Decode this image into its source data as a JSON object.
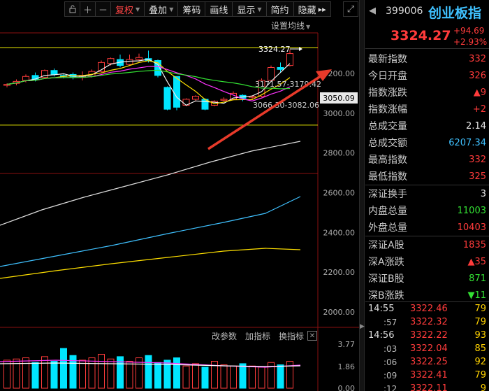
{
  "toolbar": {
    "items": [
      {
        "label": "复权",
        "dropdown": true,
        "active": true
      },
      {
        "label": "叠加",
        "dropdown": true
      },
      {
        "label": "筹码"
      },
      {
        "label": "画线"
      },
      {
        "label": "显示",
        "dropdown": true
      },
      {
        "label": "简约"
      },
      {
        "label": "隐藏"
      }
    ],
    "icons": [
      "lock-icon",
      "plus-icon",
      "minus-icon"
    ],
    "hide_arrows": "▸▸",
    "expand_glyph": "⤢"
  },
  "ma_setting": "设置均线",
  "chart_data": {
    "type": "candlestick",
    "price_label": "3324.27",
    "current_price_tag": "3050.09",
    "ma_annotations": [
      "3171.57-3179.42",
      "3066.30-3082.06"
    ],
    "y_ticks": [
      "3200.00",
      "3000.00",
      "2800.00",
      "2600.00",
      "2400.00",
      "2200.00",
      "2000.00"
    ],
    "volume_ticks": [
      "3.77",
      "1.86",
      "0.00"
    ],
    "ylim": [
      1950,
      3350
    ],
    "candles": [
      {
        "o": 3140,
        "c": 3145,
        "h": 3150,
        "l": 3130
      },
      {
        "o": 3150,
        "c": 3160,
        "h": 3170,
        "l": 3140
      },
      {
        "o": 3165,
        "c": 3185,
        "h": 3195,
        "l": 3155
      },
      {
        "o": 3190,
        "c": 3170,
        "h": 3205,
        "l": 3160
      },
      {
        "o": 3180,
        "c": 3215,
        "h": 3220,
        "l": 3175
      },
      {
        "o": 3215,
        "c": 3195,
        "h": 3225,
        "l": 3185
      },
      {
        "o": 3190,
        "c": 3185,
        "h": 3200,
        "l": 3175
      },
      {
        "o": 3195,
        "c": 3180,
        "h": 3205,
        "l": 3170
      },
      {
        "o": 3180,
        "c": 3190,
        "h": 3210,
        "l": 3165
      },
      {
        "o": 3185,
        "c": 3210,
        "h": 3220,
        "l": 3180
      },
      {
        "o": 3210,
        "c": 3255,
        "h": 3265,
        "l": 3205
      },
      {
        "o": 3250,
        "c": 3275,
        "h": 3280,
        "l": 3240
      },
      {
        "o": 3270,
        "c": 3240,
        "h": 3295,
        "l": 3230
      },
      {
        "o": 3245,
        "c": 3270,
        "h": 3295,
        "l": 3240
      },
      {
        "o": 3270,
        "c": 3280,
        "h": 3300,
        "l": 3260
      },
      {
        "o": 3275,
        "c": 3265,
        "h": 3315,
        "l": 3255
      },
      {
        "o": 3265,
        "c": 3190,
        "h": 3270,
        "l": 3180
      },
      {
        "o": 3130,
        "c": 3020,
        "h": 3135,
        "l": 3015
      },
      {
        "o": 3185,
        "c": 3030,
        "h": 3185,
        "l": 3015
      },
      {
        "o": 3040,
        "c": 3070,
        "h": 3075,
        "l": 3035
      },
      {
        "o": 3070,
        "c": 3085,
        "h": 3090,
        "l": 3060
      },
      {
        "o": 3070,
        "c": 3020,
        "h": 3075,
        "l": 3015
      },
      {
        "o": 3040,
        "c": 3060,
        "h": 3065,
        "l": 3035
      },
      {
        "o": 3065,
        "c": 3070,
        "h": 3080,
        "l": 3060
      },
      {
        "o": 3070,
        "c": 3100,
        "h": 3110,
        "l": 3065
      },
      {
        "o": 3090,
        "c": 3075,
        "h": 3095,
        "l": 3060
      },
      {
        "o": 3080,
        "c": 3085,
        "h": 3090,
        "l": 3070
      },
      {
        "o": 3085,
        "c": 3165,
        "h": 3175,
        "l": 3080
      },
      {
        "o": 3165,
        "c": 3230,
        "h": 3240,
        "l": 3160
      },
      {
        "o": 3230,
        "c": 3220,
        "h": 3255,
        "l": 3205
      },
      {
        "o": 3240,
        "c": 3300,
        "h": 3320,
        "l": 3235
      }
    ],
    "volumes": [
      2.4,
      2.5,
      2.6,
      2.2,
      2.7,
      2.3,
      3.4,
      2.8,
      2.4,
      2.6,
      2.9,
      2.5,
      2.7,
      2.3,
      2.6,
      2.8,
      2.2,
      2.4,
      2.6,
      1.9,
      2.1,
      1.8,
      2.3,
      2.0,
      1.9,
      2.1,
      1.9,
      1.8,
      2.2,
      2.0,
      2.3
    ]
  },
  "indicator_bar": [
    "改参数",
    "加指标",
    "换指标"
  ],
  "indicator_close": "✕",
  "panel": {
    "code": "399006",
    "name": "创业板指",
    "price": "3324.27",
    "change": "+94.69",
    "change_pct": "+2.93%",
    "stats_group1": [
      {
        "label": "最新指数",
        "value": "332",
        "color": "red"
      },
      {
        "label": "今日开盘",
        "value": "326",
        "color": "red"
      },
      {
        "label": "指数涨跌",
        "value": "▲9",
        "color": "red"
      },
      {
        "label": "指数涨幅",
        "value": "+2",
        "color": "red"
      },
      {
        "label": "总成交量",
        "value": "2.14",
        "color": "white"
      },
      {
        "label": "总成交额",
        "value": "6207.34",
        "color": "cyan"
      },
      {
        "label": "最高指数",
        "value": "332",
        "color": "red"
      },
      {
        "label": "最低指数",
        "value": "325",
        "color": "red"
      }
    ],
    "stats_group2": [
      {
        "label": "深证换手",
        "value": "3",
        "color": "white"
      },
      {
        "label": "内盘总量",
        "value": "11003",
        "color": "green"
      },
      {
        "label": "外盘总量",
        "value": "10403",
        "color": "red"
      }
    ],
    "stats_group3": [
      {
        "label": "深证A股",
        "value": "1835",
        "color": "red"
      },
      {
        "label": "深A涨跌",
        "value": "▲35",
        "color": "red"
      },
      {
        "label": "深证B股",
        "value": "871",
        "color": "green"
      },
      {
        "label": "深B涨跌",
        "value": "▼11",
        "color": "green"
      }
    ],
    "ticks": [
      {
        "time": "14:55",
        "sub": false,
        "price": "3322.46",
        "vol": "79"
      },
      {
        "time": ":57",
        "sub": true,
        "price": "3322.32",
        "vol": "79"
      },
      {
        "time": "14:56",
        "sub": false,
        "price": "3322.22",
        "vol": "93"
      },
      {
        "time": ":03",
        "sub": true,
        "price": "3322.04",
        "vol": "85"
      },
      {
        "time": ":06",
        "sub": true,
        "price": "3322.25",
        "vol": "92"
      },
      {
        "time": ":09",
        "sub": true,
        "price": "3322.41",
        "vol": "79"
      },
      {
        "time": ":12",
        "sub": true,
        "price": "3322.11",
        "vol": "9"
      }
    ]
  }
}
